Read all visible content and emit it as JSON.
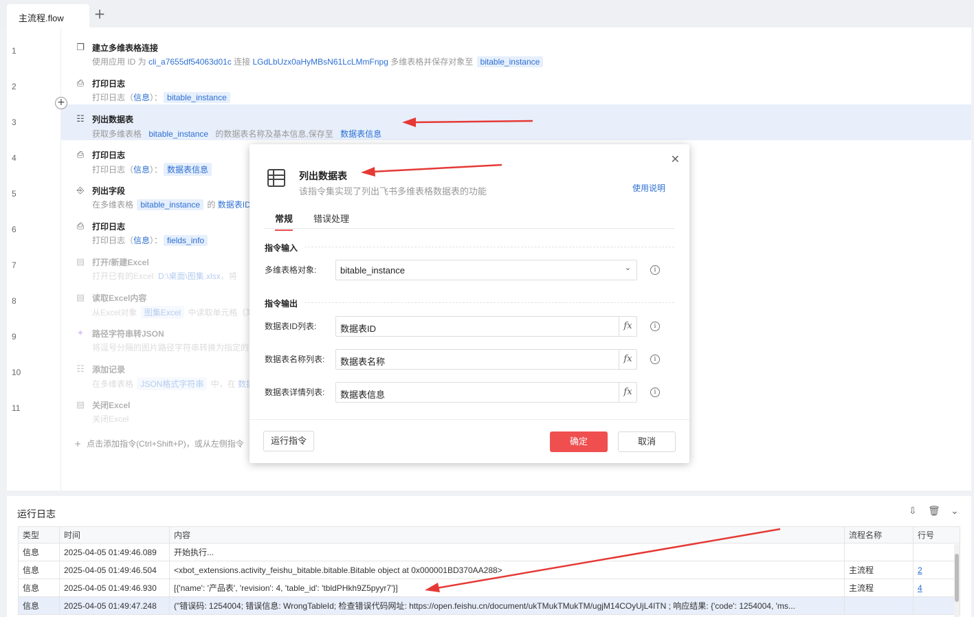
{
  "tab": {
    "label": "主流程.flow",
    "add": "+"
  },
  "flow": {
    "line_numbers": [
      "1",
      "2",
      "3",
      "4",
      "5",
      "6",
      "7",
      "8",
      "9",
      "10",
      "11"
    ],
    "rows": [
      {
        "title": "建立多维表格连接",
        "d1": "使用应用 ID 为 ",
        "d2": "cli_a7655df54063d01c",
        "d3": " 连接 ",
        "d4": "LGdLbUzx0aHyMBsN61LcLMmFnpg",
        "d5": " 多维表格并保存对象至 ",
        "d6": "bitable_instance"
      },
      {
        "title": "打印日志",
        "d1": "打印日志（",
        "d2": "信息",
        "d3": "）：",
        "d4": "bitable_instance"
      },
      {
        "title": "列出数据表",
        "d1": "获取多维表格 ",
        "d2": "bitable_instance",
        "d3": " 的数据表名称及基本信息,保存至 ",
        "d4": "数据表信息"
      },
      {
        "title": "打印日志",
        "d1": "打印日志（",
        "d2": "信息",
        "d3": "）：",
        "d4": "数据表信息"
      },
      {
        "title": "列出字段",
        "d1": "在多维表格 ",
        "d2": "bitable_instance",
        "d3": " 的 ",
        "d4": "数据表ID"
      },
      {
        "title": "打印日志",
        "d1": "打印日志（",
        "d2": "信息",
        "d3": "）：",
        "d4": "fields_info"
      },
      {
        "title": "打开/新建Excel",
        "d1": "打开已有的Excel",
        "d2": "D:\\桌面\\图集.xlsx",
        "d3": "，将 "
      },
      {
        "title": "读取Excel内容",
        "d1": "从Excel对象 ",
        "d2": "图集Excel",
        "d3": " 中读取单元格（某"
      },
      {
        "title": "路径字符串转JSON",
        "d1": "将逗号分隔的图片路径字符串转换为指定的"
      },
      {
        "title": "添加记录",
        "d1": "在多维表格 ",
        "d2": "JSON格式字符串",
        "d3": " 中，在 ",
        "d4": "数据"
      },
      {
        "title": "关闭Excel",
        "d1": "关闭Excel"
      }
    ],
    "add_hint": "点击添加指令(Ctrl+Shift+P)，或从左侧指令",
    "add_hint_plus": "+"
  },
  "modal": {
    "close": "✕",
    "title": "列出数据表",
    "subtitle": "该指令集实现了列出飞书多维表格数据表的功能",
    "help": "使用说明",
    "tabs": [
      "常规",
      "错误处理"
    ],
    "input_section": "指令输入",
    "input_label": "多维表格对象:",
    "input_value": "bitable_instance",
    "output_section": "指令输出",
    "outputs": [
      {
        "label": "数据表ID列表:",
        "value": "数据表ID"
      },
      {
        "label": "数据表名称列表:",
        "value": "数据表名称"
      },
      {
        "label": "数据表详情列表:",
        "value": "数据表信息"
      }
    ],
    "fx": "fx",
    "info": "i",
    "chevron": "⌄",
    "run_button": "运行指令",
    "ok_button": "确定",
    "cancel_button": "取消"
  },
  "log": {
    "title": "运行日志",
    "tools": [
      "⇩",
      "🗑",
      "⌄"
    ],
    "columns": [
      "类型",
      "时间",
      "内容",
      "流程名称",
      "行号"
    ],
    "rows": [
      [
        "信息",
        "2025-04-05 01:49:46.089",
        "开始执行...",
        "",
        ""
      ],
      [
        "信息",
        "2025-04-05 01:49:46.504",
        "<xbot_extensions.activity_feishu_bitable.bitable.Bitable object at 0x000001BD370AA288>",
        "主流程",
        "2"
      ],
      [
        "信息",
        "2025-04-05 01:49:46.930",
        "[{'name': '产品表', 'revision': 4, 'table_id': 'tbldPHkh9Z5pyyr7'}]",
        "主流程",
        "4"
      ],
      [
        "信息",
        "2025-04-05 01:49:47.248",
        "(\"错误码: 1254004; 错误信息: WrongTableId; 检查错误代码网址: https://open.feishu.cn/document/ukTMukTMukTM/ugjM14COyUjL4ITN ; 响应结果: {'code': 1254004, 'ms...",
        "",
        ""
      ]
    ]
  },
  "colors": {
    "accent": "#2d6fd2",
    "danger": "#ef4f4f",
    "selected_row": "#e8eefa"
  },
  "icons": [
    "window-icon",
    "printer-icon",
    "table-icon",
    "field-list-icon",
    "excel-icon",
    "sparkle-icon",
    "export-icon",
    "trash-icon",
    "chevron-down-icon",
    "info-icon",
    "fx-icon",
    "close-icon"
  ]
}
